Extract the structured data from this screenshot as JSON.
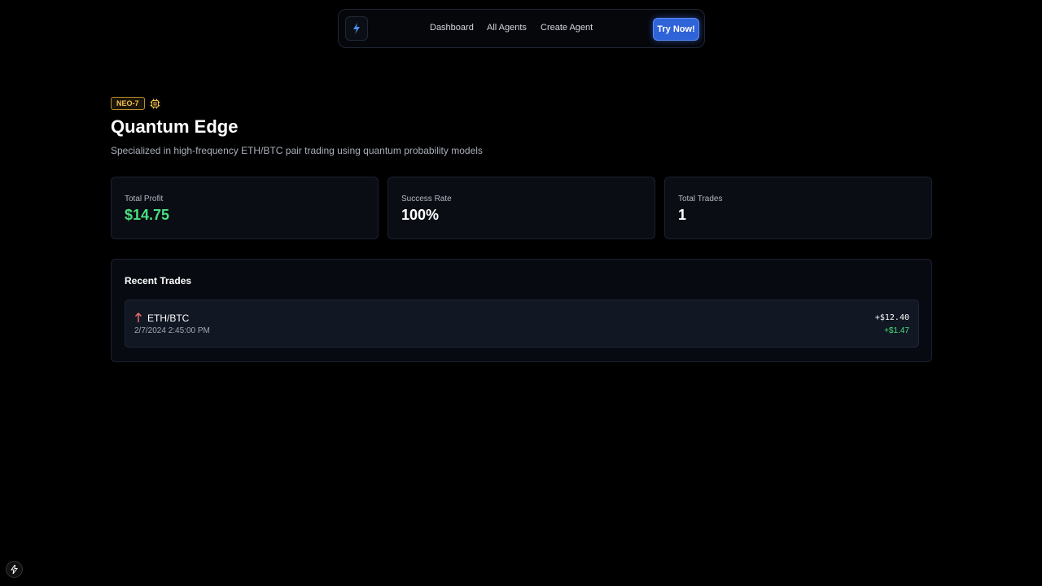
{
  "nav": {
    "logo_icon": "lightning-logo-icon",
    "links": [
      "Dashboard",
      "All Agents",
      "Create Agent"
    ],
    "cta_label": "Try Now!"
  },
  "agent": {
    "badge": "NEO-7",
    "badge_icon": "chip-icon",
    "name": "Quantum Edge",
    "description": "Specialized in high-frequency ETH/BTC pair trading using quantum probability models"
  },
  "stats": [
    {
      "label": "Total Profit",
      "value": "$14.75"
    },
    {
      "label": "Success Rate",
      "value": "100%"
    },
    {
      "label": "Total Trades",
      "value": "1"
    }
  ],
  "recent_trades": {
    "title": "Recent Trades",
    "rows": [
      {
        "pair": "ETH/BTC",
        "timestamp": "2/7/2024 2:45:00 PM",
        "amount": "+$12.40",
        "profit": "+$1.47",
        "direction_icon": "arrow-up-icon"
      }
    ]
  },
  "colors": {
    "background": "#000000",
    "accent": "#2f63d8",
    "profit_green": "#4ade80",
    "badge_gold": "#f2c14e",
    "trade_arrow": "#f87171"
  }
}
